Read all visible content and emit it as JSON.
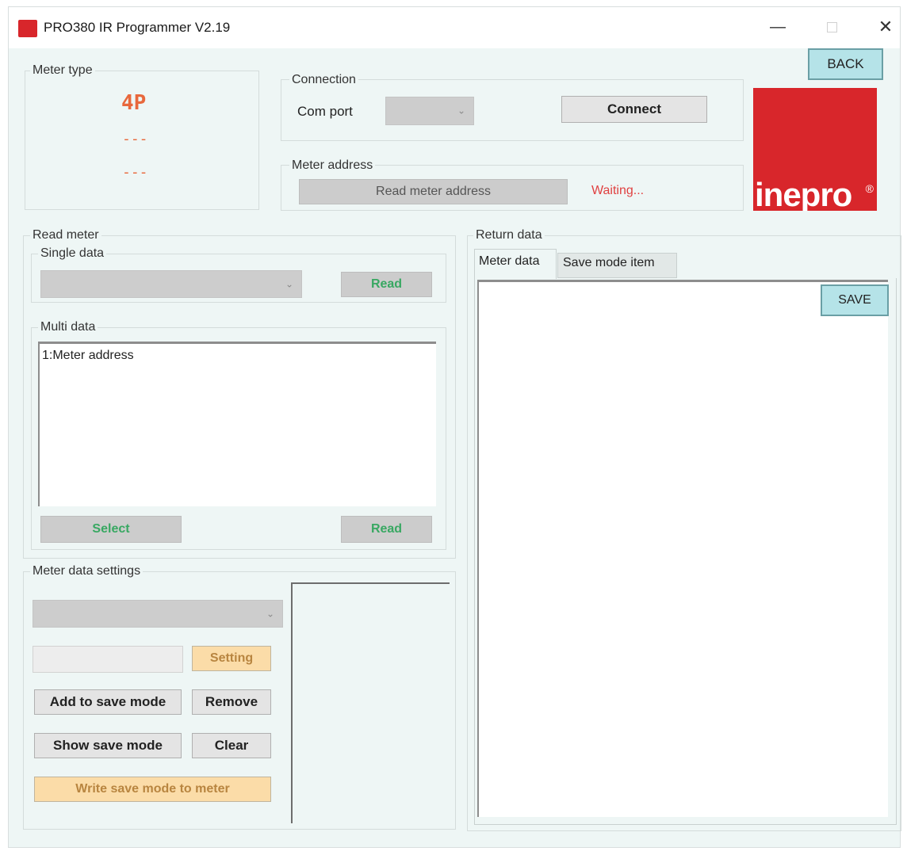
{
  "window": {
    "title": "PRO380 IR Programmer V2.19",
    "controls": {
      "minimize": "—",
      "close": "✕"
    }
  },
  "back_button": "BACK",
  "meter_type": {
    "label": "Meter type",
    "line1": "4P",
    "line2": "---",
    "line3": "---",
    "accent_color": "#e8683c"
  },
  "connection": {
    "label": "Connection",
    "com_port_label": "Com port",
    "com_port_value": "",
    "connect_button": "Connect"
  },
  "meter_address": {
    "label": "Meter address",
    "read_button": "Read meter address",
    "status": "Waiting...",
    "status_color": "#e04040"
  },
  "logo": {
    "text": "inepro",
    "mark": "®",
    "brand_color": "#d8262b"
  },
  "read_meter": {
    "label": "Read meter",
    "single": {
      "label": "Single data",
      "combo_value": "",
      "read_button": "Read"
    },
    "multi": {
      "label": "Multi data",
      "items": [
        "1:Meter address"
      ],
      "select_button": "Select",
      "read_button": "Read"
    }
  },
  "meter_data_settings": {
    "label": "Meter data settings",
    "combo_value": "",
    "input_value": "",
    "setting_button": "Setting",
    "add_button": "Add to save mode",
    "remove_button": "Remove",
    "show_button": "Show save mode",
    "clear_button": "Clear",
    "write_button": "Write save mode to meter"
  },
  "return_data": {
    "label": "Return data",
    "tabs": [
      "Meter data",
      "Save mode item"
    ],
    "active_tab": "Meter data",
    "save_button": "SAVE",
    "content": ""
  }
}
